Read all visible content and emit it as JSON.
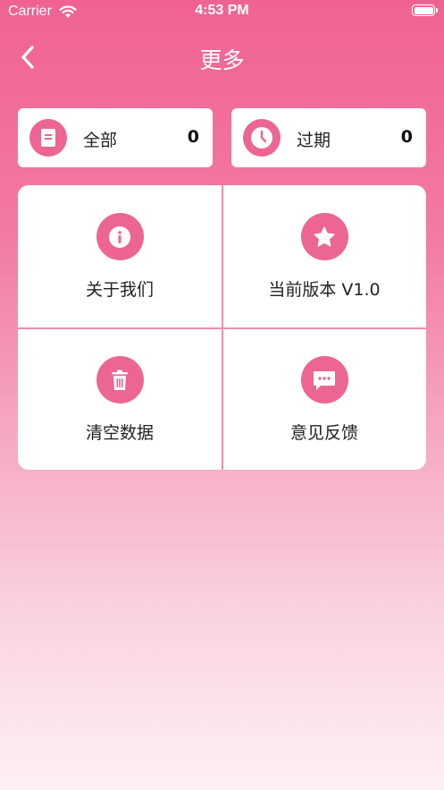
{
  "status_bar": {
    "carrier": "Carrier",
    "time": "4:53 PM"
  },
  "nav": {
    "title": "更多",
    "back_icon": "chevron-left-icon"
  },
  "stats": [
    {
      "label": "全部",
      "count": "0",
      "icon": "document-icon"
    },
    {
      "label": "过期",
      "count": "0",
      "icon": "clock-icon"
    }
  ],
  "menu": [
    {
      "label": "关于我们",
      "icon": "info-icon"
    },
    {
      "label": "当前版本 V1.0",
      "icon": "star-icon"
    },
    {
      "label": "清空数据",
      "icon": "trash-icon"
    },
    {
      "label": "意见反馈",
      "icon": "chat-bubble-icon"
    }
  ],
  "colors": {
    "accent": "#ec6593",
    "header": "#f06292",
    "card": "#ffffff"
  }
}
